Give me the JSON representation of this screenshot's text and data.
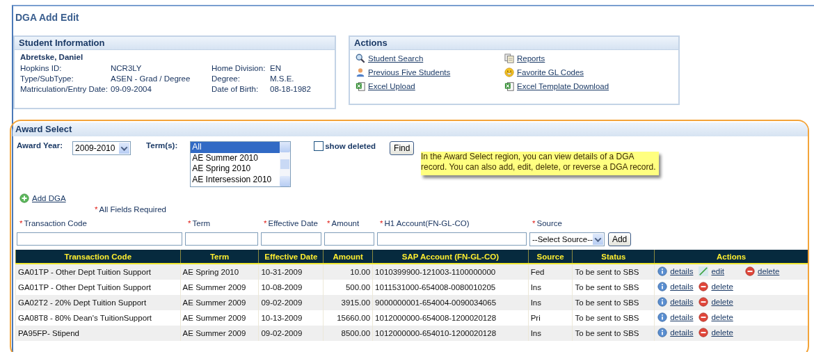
{
  "page_title": "DGA Add Edit",
  "student_info": {
    "title": "Student Information",
    "name": "Abretske, Daniel",
    "fields": [
      {
        "label": "Hopkins ID:",
        "value": "NCR3LY"
      },
      {
        "label": "Home Division:",
        "value": "EN"
      },
      {
        "label": "Type/SubType:",
        "value": "ASEN - Grad / Degree"
      },
      {
        "label": "Degree:",
        "value": "M.S.E."
      },
      {
        "label": "Matriculation/Entry Date:",
        "value": "09-09-2004"
      },
      {
        "label": "Date of Birth:",
        "value": "08-18-1982"
      }
    ]
  },
  "actions": {
    "title": "Actions",
    "links": [
      {
        "kind": "search",
        "label": "Student Search"
      },
      {
        "kind": "reports",
        "label": "Reports"
      },
      {
        "kind": "person",
        "label": "Previous Five Students"
      },
      {
        "kind": "smiley",
        "label": "Favorite GL Codes"
      },
      {
        "kind": "excel",
        "label": "Excel Upload"
      },
      {
        "kind": "excel",
        "label": "Excel Template Download"
      }
    ]
  },
  "award_select": {
    "title": "Award Select",
    "award_year": {
      "label": "Award Year:",
      "value": "2009-2010"
    },
    "terms": {
      "label": "Term(s):",
      "options": [
        {
          "label": "All",
          "selected": true
        },
        {
          "label": "AE Summer 2010",
          "selected": false
        },
        {
          "label": "AE Spring 2010",
          "selected": false
        },
        {
          "label": "AE Intersession 2010",
          "selected": false
        }
      ]
    },
    "show_deleted": {
      "label": "show deleted",
      "checked": false
    },
    "find_button": "Find",
    "callout": "In the Award Select region, you can view details of a DGA record.  You can also add, edit, delete, or reverse a DGA record.",
    "add_link": "Add DGA",
    "required_marker": "*",
    "required_note": "All Fields Required",
    "form_fields": [
      {
        "kind": "input",
        "label": "Transaction Code",
        "required": true
      },
      {
        "kind": "input",
        "label": "Term",
        "required": true
      },
      {
        "kind": "input",
        "label": "Effective Date",
        "required": true
      },
      {
        "kind": "input",
        "label": "Amount",
        "required": true
      },
      {
        "kind": "input",
        "label": "H1 Account(FN-GL-CO)",
        "required": true
      },
      {
        "kind": "select",
        "label": "Source",
        "value": "--Select Source--",
        "required": true
      }
    ],
    "add_button": "Add",
    "table": {
      "columns": [
        "Transaction Code",
        "Term",
        "Effective Date",
        "Amount",
        "SAP Account (FN-GL-CO)",
        "Source",
        "Status",
        "Actions"
      ],
      "rows": [
        {
          "cells": [
            "GA01TP - Other Dept Tuition Support",
            "AE Spring 2010",
            "10-31-2009",
            "10.00",
            "1010399900-121003-1100000000",
            "Fed",
            "To be sent to SBS"
          ],
          "actions": [
            {
              "kind": "details",
              "label": "details"
            },
            {
              "kind": "edit",
              "label": "edit"
            },
            {
              "kind": "delete",
              "label": "delete"
            }
          ]
        },
        {
          "cells": [
            "GA01TP - Other Dept Tuition Support",
            "AE Summer 2009",
            "10-08-2009",
            "500.00",
            "1011531000-654008-0080010205",
            "Ins",
            "To be sent to SBS"
          ],
          "actions": [
            {
              "kind": "details",
              "label": "details"
            },
            {
              "kind": "delete",
              "label": "delete"
            }
          ]
        },
        {
          "cells": [
            "GA02T2 - 20% Dept Tuition Support",
            "AE Summer 2009",
            "09-02-2009",
            "3915.00",
            "9000000001-654004-0090034065",
            "Ins",
            "To be sent to SBS"
          ],
          "actions": [
            {
              "kind": "details",
              "label": "details"
            },
            {
              "kind": "delete",
              "label": "delete"
            }
          ]
        },
        {
          "cells": [
            "GA08T8 - 80% Dean's TuitionSupport",
            "AE Summer 2009",
            "10-13-2009",
            "15660.00",
            "1012000000-654008-1200020128",
            "Pri",
            "To be sent to SBS"
          ],
          "actions": [
            {
              "kind": "details",
              "label": "details"
            },
            {
              "kind": "delete",
              "label": "delete"
            }
          ]
        },
        {
          "cells": [
            "PA95FP- Stipend",
            "AE Summer 2009",
            "09-02-2009",
            "8500.00",
            "1012000000-654010-1200020128",
            "Ins",
            "To be sent to SBS"
          ],
          "actions": [
            {
              "kind": "details",
              "label": "details"
            },
            {
              "kind": "delete",
              "label": "delete"
            }
          ]
        }
      ]
    }
  }
}
